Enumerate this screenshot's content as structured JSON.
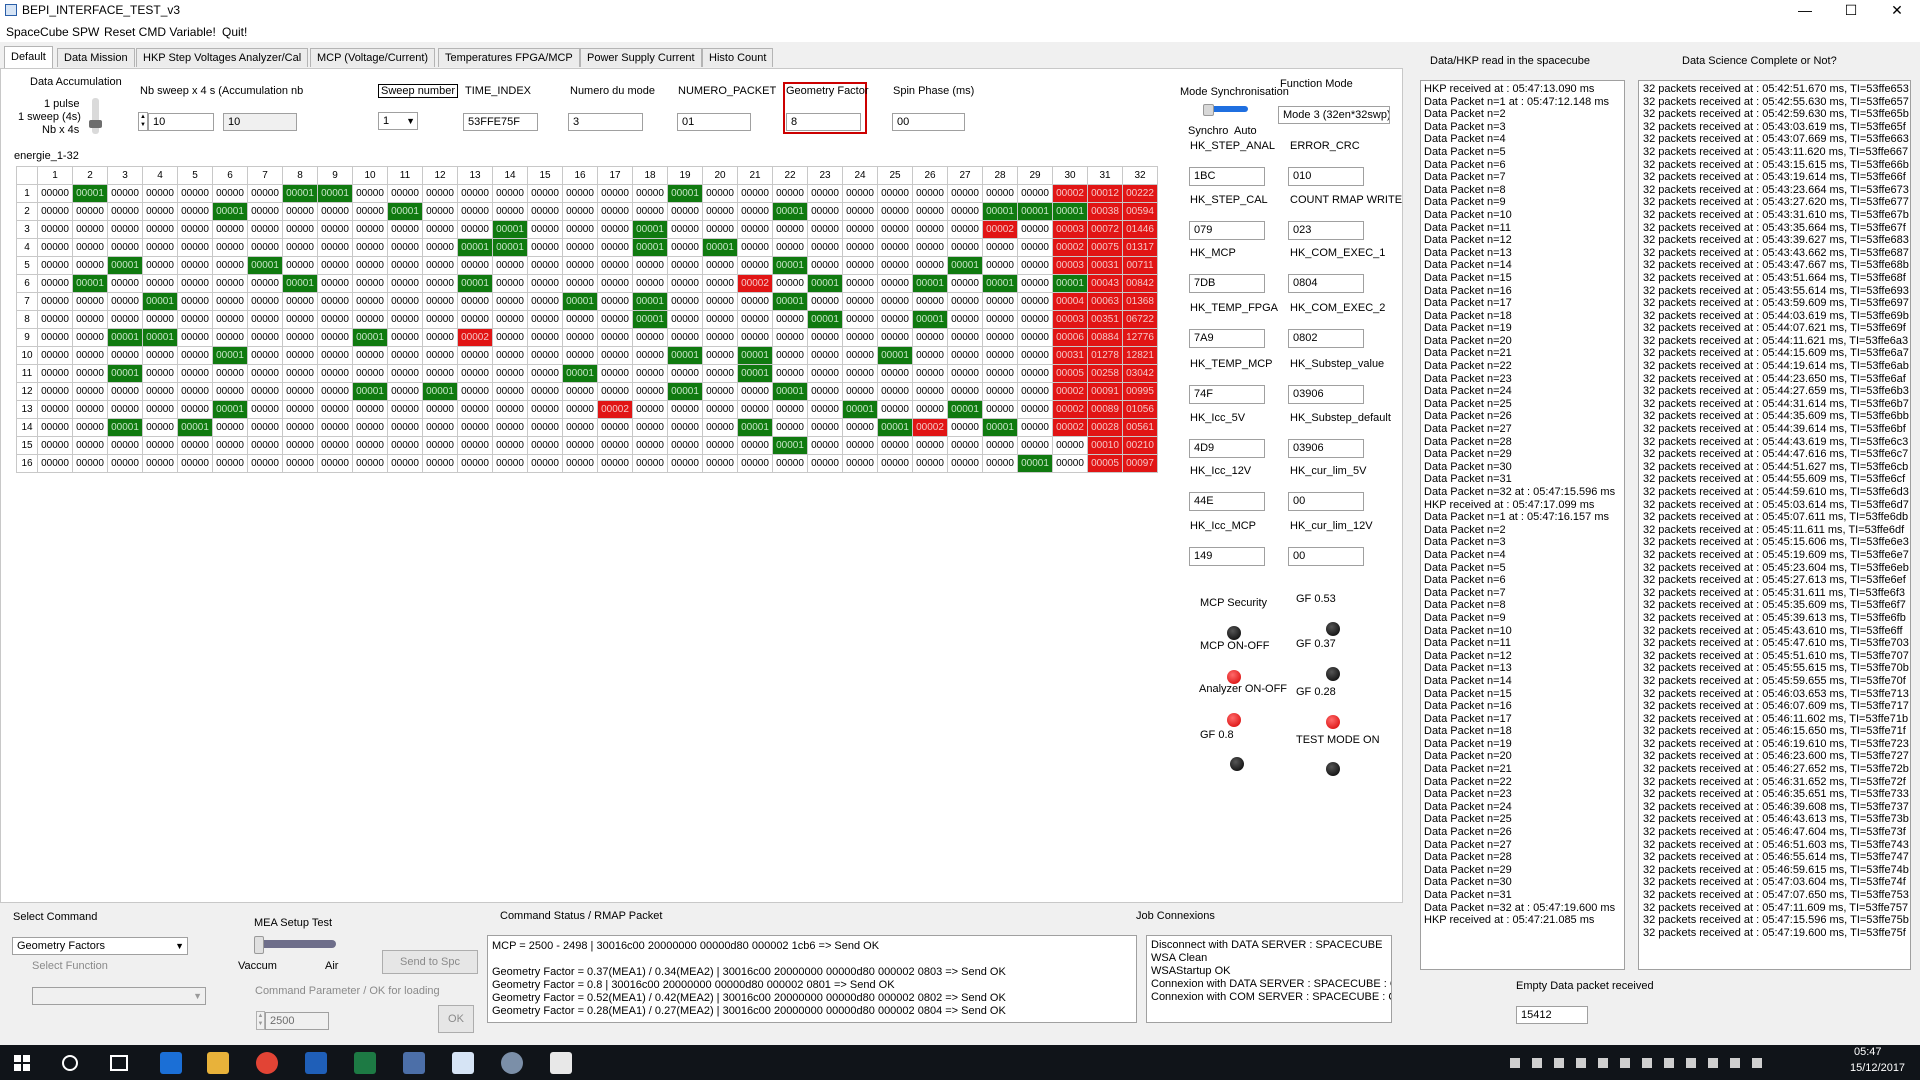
{
  "window": {
    "title": "BEPI_INTERFACE_TEST_v3"
  },
  "menu": [
    "SpaceCube SPW",
    "Reset CMD Variable!",
    "Quit!"
  ],
  "tabs": [
    "Default",
    "Data Mission",
    "HKP Step Voltages Analyzer/Cal",
    "MCP (Voltage/Current)",
    "Temperatures FPGA/MCP",
    "Power Supply Current",
    "Histo Count"
  ],
  "controls": {
    "data_accumulation": "Data Accumulation",
    "slider_labels": [
      "1 pulse",
      "1 sweep (4s)",
      "Nb x 4s"
    ],
    "nb_sweep_label": "Nb sweep x 4 s (",
    "accumulation_label": "Accumulation nb",
    "nb_sweep_value": "10",
    "accumulation_value": "10",
    "sweep_number_label": "Sweep number",
    "sweep_number_value": "1",
    "time_index_label": "TIME_INDEX",
    "time_index_value": "53FFE75F",
    "numero_mode_label": "Numero du mode",
    "numero_mode_value": "3",
    "numero_packet_label": "NUMERO_PACKET",
    "numero_packet_value": "01",
    "geometry_factor_label": "Geometry Factor",
    "geometry_factor_value": "8",
    "spin_phase_label": "Spin Phase (ms)",
    "spin_phase_value": "00",
    "mode_sync_label": "Mode Synchronisation",
    "sync_left": "Synchro",
    "sync_right": "Auto",
    "function_mode_label": "Function Mode",
    "function_mode_value": "Mode 3 (32en*32swp)"
  },
  "grid": {
    "title": "energie_1-32",
    "columns": [
      "1",
      "2",
      "3",
      "4",
      "5",
      "6",
      "7",
      "8",
      "9",
      "10",
      "11",
      "12",
      "13",
      "14",
      "15",
      "16",
      "17",
      "18",
      "19",
      "20",
      "21",
      "22",
      "23",
      "24",
      "25",
      "26",
      "27",
      "28",
      "29",
      "30",
      "31",
      "32"
    ],
    "rows": [
      {
        "label": "1",
        "overrides": {
          "2": "00001",
          "8": "00001",
          "9": "00001",
          "19": "00001",
          "30": "00002",
          "31": "00012",
          "32": "00222"
        }
      },
      {
        "label": "2",
        "overrides": {
          "6": "00001",
          "11": "00001",
          "22": "00001",
          "28": "00001",
          "29": "00001",
          "30": "00001",
          "31": "00038",
          "32": "00594"
        }
      },
      {
        "label": "3",
        "overrides": {
          "14": "00001",
          "18": "00001",
          "28": "00002",
          "30": "00003",
          "31": "00072",
          "32": "01446"
        }
      },
      {
        "label": "4",
        "overrides": {
          "13": "00001",
          "14": "00001",
          "18": "00001",
          "20": "00001",
          "30": "00002",
          "31": "00075",
          "32": "01317"
        }
      },
      {
        "label": "5",
        "overrides": {
          "3": "00001",
          "7": "00001",
          "22": "00001",
          "27": "00001",
          "30": "00003",
          "31": "00031",
          "32": "00711"
        }
      },
      {
        "label": "6",
        "overrides": {
          "2": "00001",
          "8": "00001",
          "13": "00001",
          "21": "00002",
          "23": "00001",
          "26": "00001",
          "28": "00001",
          "30": "00001",
          "31": "00043",
          "32": "00842"
        }
      },
      {
        "label": "7",
        "overrides": {
          "4": "00001",
          "16": "00001",
          "18": "00001",
          "22": "00001",
          "30": "00004",
          "31": "00063",
          "32": "01368"
        }
      },
      {
        "label": "8",
        "overrides": {
          "18": "00001",
          "23": "00001",
          "26": "00001",
          "30": "00003",
          "31": "00351",
          "32": "06722"
        }
      },
      {
        "label": "9",
        "overrides": {
          "3": "00001",
          "4": "00001",
          "10": "00001",
          "13": "00002",
          "30": "00006",
          "31": "00884",
          "32": "12776"
        }
      },
      {
        "label": "10",
        "overrides": {
          "6": "00001",
          "19": "00001",
          "21": "00001",
          "25": "00001",
          "30": "00031",
          "31": "01278",
          "32": "12821"
        }
      },
      {
        "label": "11",
        "overrides": {
          "3": "00001",
          "16": "00001",
          "21": "00001",
          "30": "00005",
          "31": "00258",
          "32": "03042"
        }
      },
      {
        "label": "12",
        "overrides": {
          "10": "00001",
          "12": "00001",
          "19": "00001",
          "22": "00001",
          "30": "00002",
          "31": "00091",
          "32": "00995"
        }
      },
      {
        "label": "13",
        "overrides": {
          "6": "00001",
          "17": "00002",
          "24": "00001",
          "27": "00001",
          "30": "00002",
          "31": "00089",
          "32": "01056"
        }
      },
      {
        "label": "14",
        "overrides": {
          "3": "00001",
          "5": "00001",
          "21": "00001",
          "25": "00001",
          "26": "00002",
          "28": "00001",
          "30": "00002",
          "31": "00028",
          "32": "00561"
        }
      },
      {
        "label": "15",
        "overrides": {
          "22": "00001",
          "31": "00010",
          "32": "00210"
        }
      },
      {
        "label": "16",
        "overrides": {
          "29": "00001",
          "31": "00005",
          "32": "00097"
        }
      }
    ]
  },
  "hk": {
    "left": [
      {
        "label": "HK_STEP_ANAL",
        "value": "1BC"
      },
      {
        "label": "HK_STEP_CAL",
        "value": "079"
      },
      {
        "label": "HK_MCP",
        "value": "7DB"
      },
      {
        "label": "HK_TEMP_FPGA",
        "value": "7A9"
      },
      {
        "label": "HK_TEMP_MCP",
        "value": "74F"
      },
      {
        "label": "HK_Icc_5V",
        "value": "4D9"
      },
      {
        "label": "HK_Icc_12V",
        "value": "44E"
      },
      {
        "label": "HK_Icc_MCP",
        "value": "149"
      }
    ],
    "right": [
      {
        "label": "ERROR_CRC",
        "value": "010"
      },
      {
        "label": "COUNT RMAP WRITE",
        "value": "023"
      },
      {
        "label": "HK_COM_EXEC_1",
        "value": "0804"
      },
      {
        "label": "HK_COM_EXEC_2",
        "value": "0802"
      },
      {
        "label": "HK_Substep_value",
        "value": "03906"
      },
      {
        "label": "HK_Substep_default",
        "value": "03906"
      },
      {
        "label": "HK_cur_lim_5V",
        "value": "00"
      },
      {
        "label": "HK_cur_lim_12V",
        "value": "00"
      }
    ]
  },
  "leds": {
    "mcp_security": "MCP Security",
    "mcp_onoff": "MCP ON-OFF",
    "analyzer_onoff": "Analyzer ON-OFF",
    "gf08": "GF 0.8",
    "gf053": "GF 0.53",
    "gf037": "GF 0.37",
    "gf028": "GF 0.28",
    "test_mode": "TEST MODE ON"
  },
  "hkp_log": {
    "title": "Data/HKP read in the spacecube",
    "lines": [
      "HKP received at : 05:47:13.090 ms",
      "Data Packet n=1 at : 05:47:12.148 ms",
      "Data Packet n=2",
      "Data Packet n=3",
      "Data Packet n=4",
      "Data Packet n=5",
      "Data Packet n=6",
      "Data Packet n=7",
      "Data Packet n=8",
      "Data Packet n=9",
      "Data Packet n=10",
      "Data Packet n=11",
      "Data Packet n=12",
      "Data Packet n=13",
      "Data Packet n=14",
      "Data Packet n=15",
      "Data Packet n=16",
      "Data Packet n=17",
      "Data Packet n=18",
      "Data Packet n=19",
      "Data Packet n=20",
      "Data Packet n=21",
      "Data Packet n=22",
      "Data Packet n=23",
      "Data Packet n=24",
      "Data Packet n=25",
      "Data Packet n=26",
      "Data Packet n=27",
      "Data Packet n=28",
      "Data Packet n=29",
      "Data Packet n=30",
      "Data Packet n=31",
      "Data Packet n=32 at : 05:47:15.596 ms",
      "HKP received at : 05:47:17.099 ms",
      "Data Packet n=1 at : 05:47:16.157 ms",
      "Data Packet n=2",
      "Data Packet n=3",
      "Data Packet n=4",
      "Data Packet n=5",
      "Data Packet n=6",
      "Data Packet n=7",
      "Data Packet n=8",
      "Data Packet n=9",
      "Data Packet n=10",
      "Data Packet n=11",
      "Data Packet n=12",
      "Data Packet n=13",
      "Data Packet n=14",
      "Data Packet n=15",
      "Data Packet n=16",
      "Data Packet n=17",
      "Data Packet n=18",
      "Data Packet n=19",
      "Data Packet n=20",
      "Data Packet n=21",
      "Data Packet n=22",
      "Data Packet n=23",
      "Data Packet n=24",
      "Data Packet n=25",
      "Data Packet n=26",
      "Data Packet n=27",
      "Data Packet n=28",
      "Data Packet n=29",
      "Data Packet n=30",
      "Data Packet n=31",
      "Data Packet n=32 at : 05:47:19.600 ms",
      "HKP received at : 05:47:21.085 ms"
    ]
  },
  "science_log": {
    "title": "Data Science Complete or Not?",
    "lines": [
      "32 packets received at : 05:42:51.670 ms, TI=53ffe653",
      "32 packets received at : 05:42:55.630 ms, TI=53ffe657",
      "32 packets received at : 05:42:59.630 ms, TI=53ffe65b",
      "32 packets received at : 05:43:03.619 ms, TI=53ffe65f",
      "32 packets received at : 05:43:07.669 ms, TI=53ffe663",
      "32 packets received at : 05:43:11.620 ms, TI=53ffe667",
      "32 packets received at : 05:43:15.615 ms, TI=53ffe66b",
      "32 packets received at : 05:43:19.614 ms, TI=53ffe66f",
      "32 packets received at : 05:43:23.664 ms, TI=53ffe673",
      "32 packets received at : 05:43:27.620 ms, TI=53ffe677",
      "32 packets received at : 05:43:31.610 ms, TI=53ffe67b",
      "32 packets received at : 05:43:35.664 ms, TI=53ffe67f",
      "32 packets received at : 05:43:39.627 ms, TI=53ffe683",
      "32 packets received at : 05:43:43.662 ms, TI=53ffe687",
      "32 packets received at : 05:43:47.667 ms, TI=53ffe68b",
      "32 packets received at : 05:43:51.664 ms, TI=53ffe68f",
      "32 packets received at : 05:43:55.614 ms, TI=53ffe693",
      "32 packets received at : 05:43:59.609 ms, TI=53ffe697",
      "32 packets received at : 05:44:03.619 ms, TI=53ffe69b",
      "32 packets received at : 05:44:07.621 ms, TI=53ffe69f",
      "32 packets received at : 05:44:11.621 ms, TI=53ffe6a3",
      "32 packets received at : 05:44:15.609 ms, TI=53ffe6a7",
      "32 packets received at : 05:44:19.614 ms, TI=53ffe6ab",
      "32 packets received at : 05:44:23.650 ms, TI=53ffe6af",
      "32 packets received at : 05:44:27.659 ms, TI=53ffe6b3",
      "32 packets received at : 05:44:31.614 ms, TI=53ffe6b7",
      "32 packets received at : 05:44:35.609 ms, TI=53ffe6bb",
      "32 packets received at : 05:44:39.614 ms, TI=53ffe6bf",
      "32 packets received at : 05:44:43.619 ms, TI=53ffe6c3",
      "32 packets received at : 05:44:47.616 ms, TI=53ffe6c7",
      "32 packets received at : 05:44:51.627 ms, TI=53ffe6cb",
      "32 packets received at : 05:44:55.609 ms, TI=53ffe6cf",
      "32 packets received at : 05:44:59.610 ms, TI=53ffe6d3",
      "32 packets received at : 05:45:03.614 ms, TI=53ffe6d7",
      "32 packets received at : 05:45:07.611 ms, TI=53ffe6db",
      "32 packets received at : 05:45:11.611 ms, TI=53ffe6df",
      "32 packets received at : 05:45:15.606 ms, TI=53ffe6e3",
      "32 packets received at : 05:45:19.609 ms, TI=53ffe6e7",
      "32 packets received at : 05:45:23.604 ms, TI=53ffe6eb",
      "32 packets received at : 05:45:27.613 ms, TI=53ffe6ef",
      "32 packets received at : 05:45:31.611 ms, TI=53ffe6f3",
      "32 packets received at : 05:45:35.609 ms, TI=53ffe6f7",
      "32 packets received at : 05:45:39.613 ms, TI=53ffe6fb",
      "32 packets received at : 05:45:43.610 ms, TI=53ffe6ff",
      "32 packets received at : 05:45:47.610 ms, TI=53ffe703",
      "32 packets received at : 05:45:51.610 ms, TI=53ffe707",
      "32 packets received at : 05:45:55.615 ms, TI=53ffe70b",
      "32 packets received at : 05:45:59.655 ms, TI=53ffe70f",
      "32 packets received at : 05:46:03.653 ms, TI=53ffe713",
      "32 packets received at : 05:46:07.609 ms, TI=53ffe717",
      "32 packets received at : 05:46:11.602 ms, TI=53ffe71b",
      "32 packets received at : 05:46:15.650 ms, TI=53ffe71f",
      "32 packets received at : 05:46:19.610 ms, TI=53ffe723",
      "32 packets received at : 05:46:23.600 ms, TI=53ffe727",
      "32 packets received at : 05:46:27.652 ms, TI=53ffe72b",
      "32 packets received at : 05:46:31.652 ms, TI=53ffe72f",
      "32 packets received at : 05:46:35.651 ms, TI=53ffe733",
      "32 packets received at : 05:46:39.608 ms, TI=53ffe737",
      "32 packets received at : 05:46:43.613 ms, TI=53ffe73b",
      "32 packets received at : 05:46:47.604 ms, TI=53ffe73f",
      "32 packets received at : 05:46:51.603 ms, TI=53ffe743",
      "32 packets received at : 05:46:55.614 ms, TI=53ffe747",
      "32 packets received at : 05:46:59.615 ms, TI=53ffe74b",
      "32 packets received at : 05:47:03.604 ms, TI=53ffe74f",
      "32 packets received at : 05:47:07.650 ms, TI=53ffe753",
      "32 packets received at : 05:47:11.609 ms, TI=53ffe757",
      "32 packets received at : 05:47:15.596 ms, TI=53ffe75b",
      "32 packets received at : 05:47:19.600 ms, TI=53ffe75f"
    ]
  },
  "empty_packet": {
    "label": "Empty Data packet received",
    "value": "15412"
  },
  "command": {
    "select_command_label": "Select Command",
    "select_command_value": "Geometry Factors",
    "select_function_label": "Select Function",
    "mea_label": "MEA Setup Test",
    "vaccum": "Vaccum",
    "air": "Air",
    "send_btn": "Send to Spc",
    "param_label": "Command Parameter / OK for loading",
    "param_value": "2500",
    "ok_btn": "OK",
    "status_title": "Command Status / RMAP Packet",
    "status_lines": [
      "MCP = 2500 - 2498     | 30016c00 20000000 00000d80 000002 1cb6     => Send OK",
      "",
      "Geometry Factor = 0.37(MEA1) / 0.34(MEA2)     | 30016c00 20000000 00000d80 000002 0803     => Send OK",
      "Geometry Factor = 0.8     | 30016c00 20000000 00000d80 000002 0801     => Send OK",
      "Geometry Factor = 0.52(MEA1) / 0.42(MEA2)     | 30016c00 20000000 00000d80 000002 0802     => Send OK",
      "Geometry Factor = 0.28(MEA1) / 0.27(MEA2)     | 30016c00 20000000 00000d80 000002 0804     => Send OK"
    ],
    "jobs_title": "Job Connexions",
    "jobs_lines": [
      "Disconnect with DATA SERVER : SPACECUBE",
      "WSA Clean",
      "WSAStartup OK",
      "Connexion with DATA SERVER : SPACECUBE : C",
      "Connexion with COM SERVER : SPACECUBE : O"
    ]
  },
  "taskbar": {
    "time": "05:47",
    "date": "15/12/2017"
  },
  "colors": {
    "green": "#107a10",
    "red": "#e11515",
    "highlight_border": "#cc0000"
  }
}
